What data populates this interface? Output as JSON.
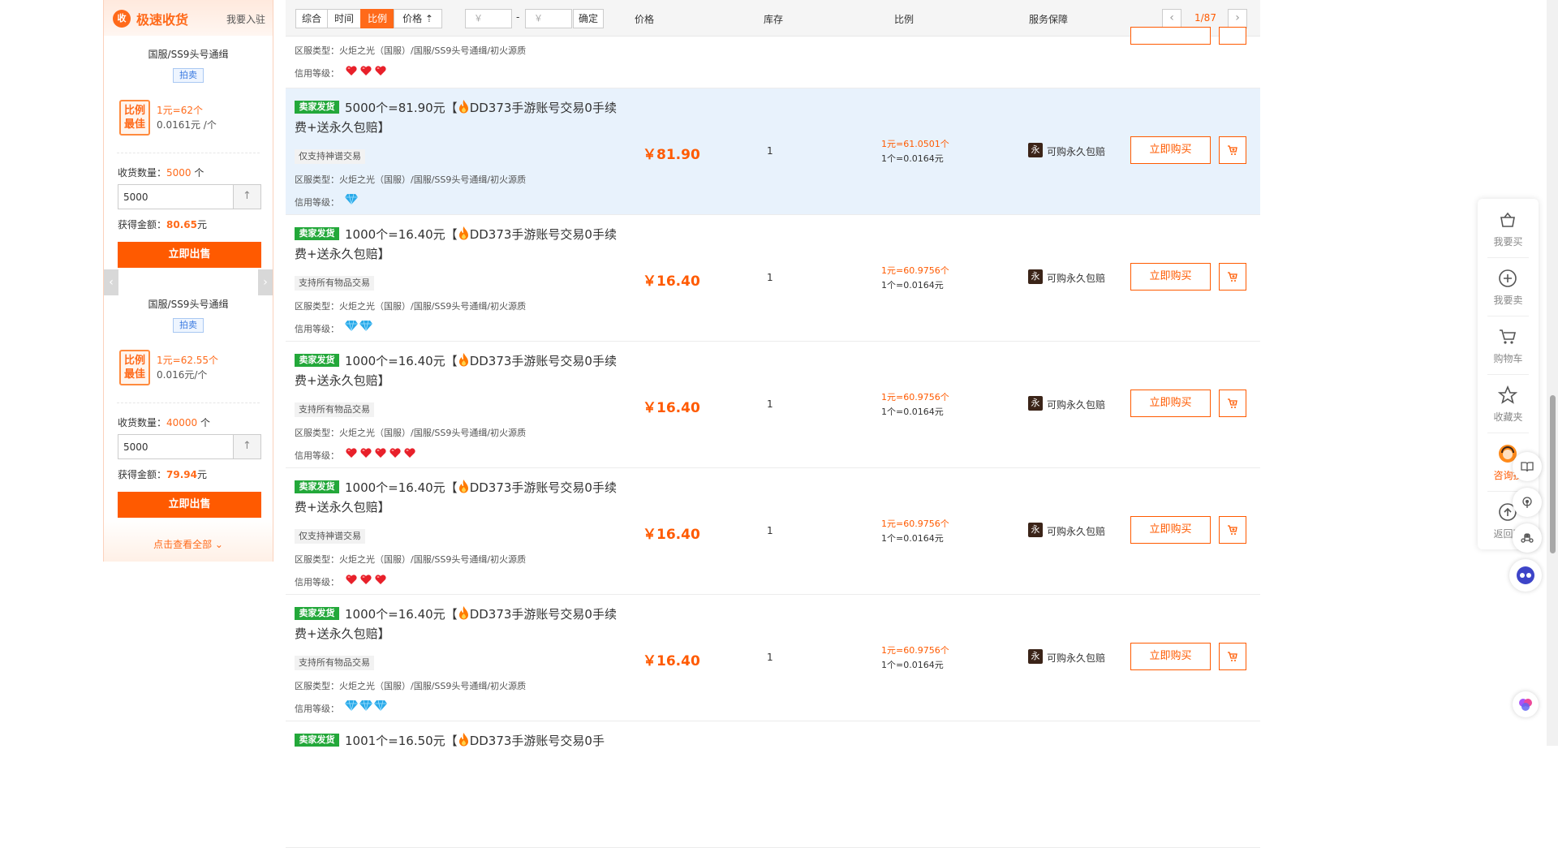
{
  "sidebar": {
    "title": "极速收货",
    "join_link": "我要入驻",
    "logo_glyph": "收",
    "cards": [
      {
        "name": "国服/SS9头号通缉",
        "badge": "拍卖",
        "best_label_1": "比例",
        "best_label_2": "最佳",
        "ratio_main": "1元=62个",
        "ratio_unit": "0.0161元 /个",
        "qty_label": "收货数量：",
        "qty_value": "5000",
        "qty_unit": " 个",
        "input_value": "5000",
        "gain_label": "获得金额：",
        "gain_value": "80.65",
        "gain_unit": "元",
        "sell_button": "立即出售"
      },
      {
        "name": "国服/SS9头号通缉",
        "badge": "拍卖",
        "best_label_1": "比例",
        "best_label_2": "最佳",
        "ratio_main": "1元=62.55个",
        "ratio_unit": "0.016元/个",
        "qty_label": "收货数量：",
        "qty_value": "40000",
        "qty_unit": " 个",
        "input_value": "5000",
        "gain_label": "获得金额：",
        "gain_value": "79.94",
        "gain_unit": "元",
        "sell_button": "立即出售"
      }
    ],
    "view_all": "点击查看全部 ⌄"
  },
  "toolbar": {
    "sorts": [
      "综合",
      "时间",
      "比例",
      "价格 ⇡"
    ],
    "active_sort": "比例",
    "price_min_placeholder": "￥",
    "price_sep": "-",
    "price_max_placeholder": "￥",
    "confirm": "确定",
    "col_price": "价格",
    "col_stock": "库存",
    "col_ratio": "比例",
    "col_service": "服务保障",
    "page_indicator": "1/87",
    "prev_glyph": "‹",
    "next_glyph": "›"
  },
  "partial_top": {
    "region": "区服类型：火炬之光（国服）/国服/SS9头号通缉/初火源质",
    "credit_label": "信用等级：",
    "credit_icons": [
      "heart",
      "heart",
      "heart"
    ]
  },
  "listings": [
    {
      "seller_badge": "卖家发货",
      "title_a": "5000个=81.90元【",
      "title_b": "DD373手游账号交易0手续费+送永久包赔】",
      "tag": "仅支持神谱交易",
      "region": "区服类型：火炬之光（国服）/国服/SS9头号通缉/初火源质",
      "credit_label": "信用等级：",
      "credit_icons": [
        "gem"
      ],
      "price": "￥81.90",
      "stock": "1",
      "ratio1": "1元=61.0501个",
      "ratio2": "1个=0.0164元",
      "service_badge": "永",
      "service": "可购永久包赔",
      "buy": "立即购买",
      "highlight": true
    },
    {
      "seller_badge": "卖家发货",
      "title_a": "1000个=16.40元【",
      "title_b": "DD373手游账号交易0手续费+送永久包赔】",
      "tag": "支持所有物品交易",
      "region": "区服类型：火炬之光（国服）/国服/SS9头号通缉/初火源质",
      "credit_label": "信用等级：",
      "credit_icons": [
        "gem",
        "gem"
      ],
      "price": "￥16.40",
      "stock": "1",
      "ratio1": "1元=60.9756个",
      "ratio2": "1个=0.0164元",
      "service_badge": "永",
      "service": "可购永久包赔",
      "buy": "立即购买",
      "highlight": false
    },
    {
      "seller_badge": "卖家发货",
      "title_a": "1000个=16.40元【",
      "title_b": "DD373手游账号交易0手续费+送永久包赔】",
      "tag": "支持所有物品交易",
      "region": "区服类型：火炬之光（国服）/国服/SS9头号通缉/初火源质",
      "credit_label": "信用等级：",
      "credit_icons": [
        "heart",
        "heart",
        "heart",
        "heart",
        "heart"
      ],
      "price": "￥16.40",
      "stock": "1",
      "ratio1": "1元=60.9756个",
      "ratio2": "1个=0.0164元",
      "service_badge": "永",
      "service": "可购永久包赔",
      "buy": "立即购买",
      "highlight": false
    },
    {
      "seller_badge": "卖家发货",
      "title_a": "1000个=16.40元【",
      "title_b": "DD373手游账号交易0手续费+送永久包赔】",
      "tag": "仅支持神谱交易",
      "region": "区服类型：火炬之光（国服）/国服/SS9头号通缉/初火源质",
      "credit_label": "信用等级：",
      "credit_icons": [
        "heart",
        "heart",
        "heart"
      ],
      "price": "￥16.40",
      "stock": "1",
      "ratio1": "1元=60.9756个",
      "ratio2": "1个=0.0164元",
      "service_badge": "永",
      "service": "可购永久包赔",
      "buy": "立即购买",
      "highlight": false
    },
    {
      "seller_badge": "卖家发货",
      "title_a": "1000个=16.40元【",
      "title_b": "DD373手游账号交易0手续费+送永久包赔】",
      "tag": "支持所有物品交易",
      "region": "区服类型：火炬之光（国服）/国服/SS9头号通缉/初火源质",
      "credit_label": "信用等级：",
      "credit_icons": [
        "gem",
        "gem",
        "gem"
      ],
      "price": "￥16.40",
      "stock": "1",
      "ratio1": "1元=60.9756个",
      "ratio2": "1个=0.0164元",
      "service_badge": "永",
      "service": "可购永久包赔",
      "buy": "立即购买",
      "highlight": false
    },
    {
      "seller_badge": "卖家发货",
      "title_a": "1001个=16.50元【",
      "title_b": "DD373手游账号交易0手",
      "highlight": false
    }
  ],
  "right_toolbar": {
    "items": [
      {
        "label": "我要买",
        "icon": "basket-icon"
      },
      {
        "label": "我要卖",
        "icon": "plus-circle-icon"
      },
      {
        "label": "购物车",
        "icon": "cart-icon"
      },
      {
        "label": "收藏夹",
        "icon": "star-icon"
      },
      {
        "label": "咨询投",
        "icon": "support-avatar-icon"
      },
      {
        "label": "返回顶",
        "icon": "back-to-top-icon"
      }
    ]
  },
  "colors": {
    "accent": "#ff5a00",
    "seller_badge": "#23a83a",
    "highlight_row": "#e8f2fc",
    "heart": "#e8202a",
    "gem": "#29a9e8"
  }
}
